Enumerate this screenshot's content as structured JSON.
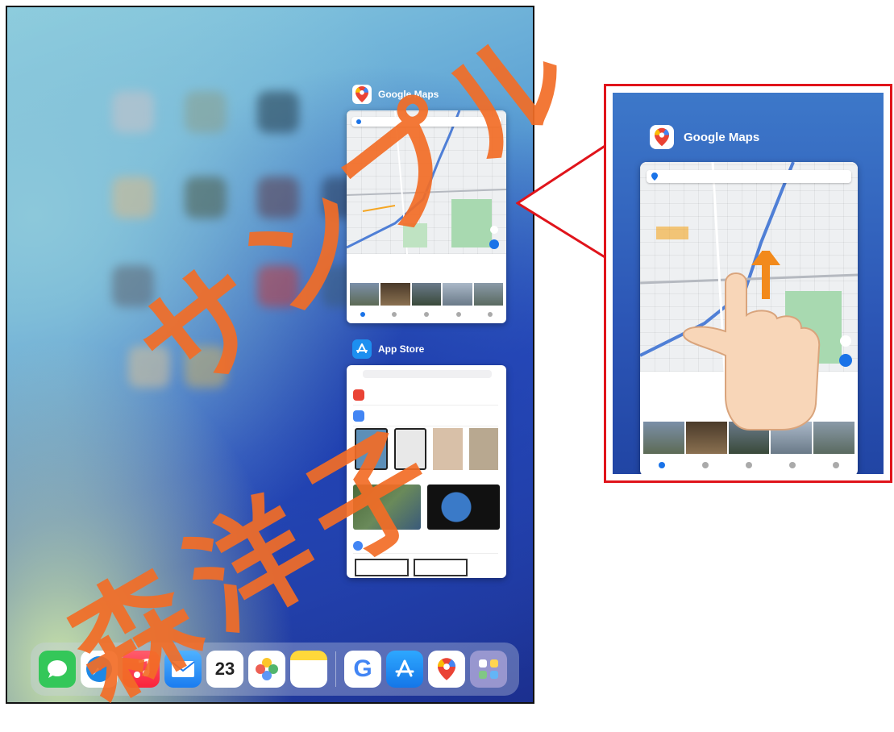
{
  "switcher": {
    "maps_label": "Google Maps",
    "appstore_label": "App Store"
  },
  "callout": {
    "maps_label": "Google Maps"
  },
  "dock": {
    "items": [
      "messages-icon",
      "safari-icon",
      "music-icon",
      "mail-icon",
      "calendar-icon",
      "photos-icon",
      "notes-icon",
      "google-icon",
      "appstore-icon",
      "maps-icon",
      "app-library-icon"
    ],
    "calendar_day": "23",
    "google_letter": "G"
  },
  "watermark": {
    "line1": "サンプル",
    "line2": "森洋子"
  },
  "colors": {
    "watermark": "#f26c26",
    "callout_border": "#e0141b",
    "arrow": "#f28a1c"
  }
}
